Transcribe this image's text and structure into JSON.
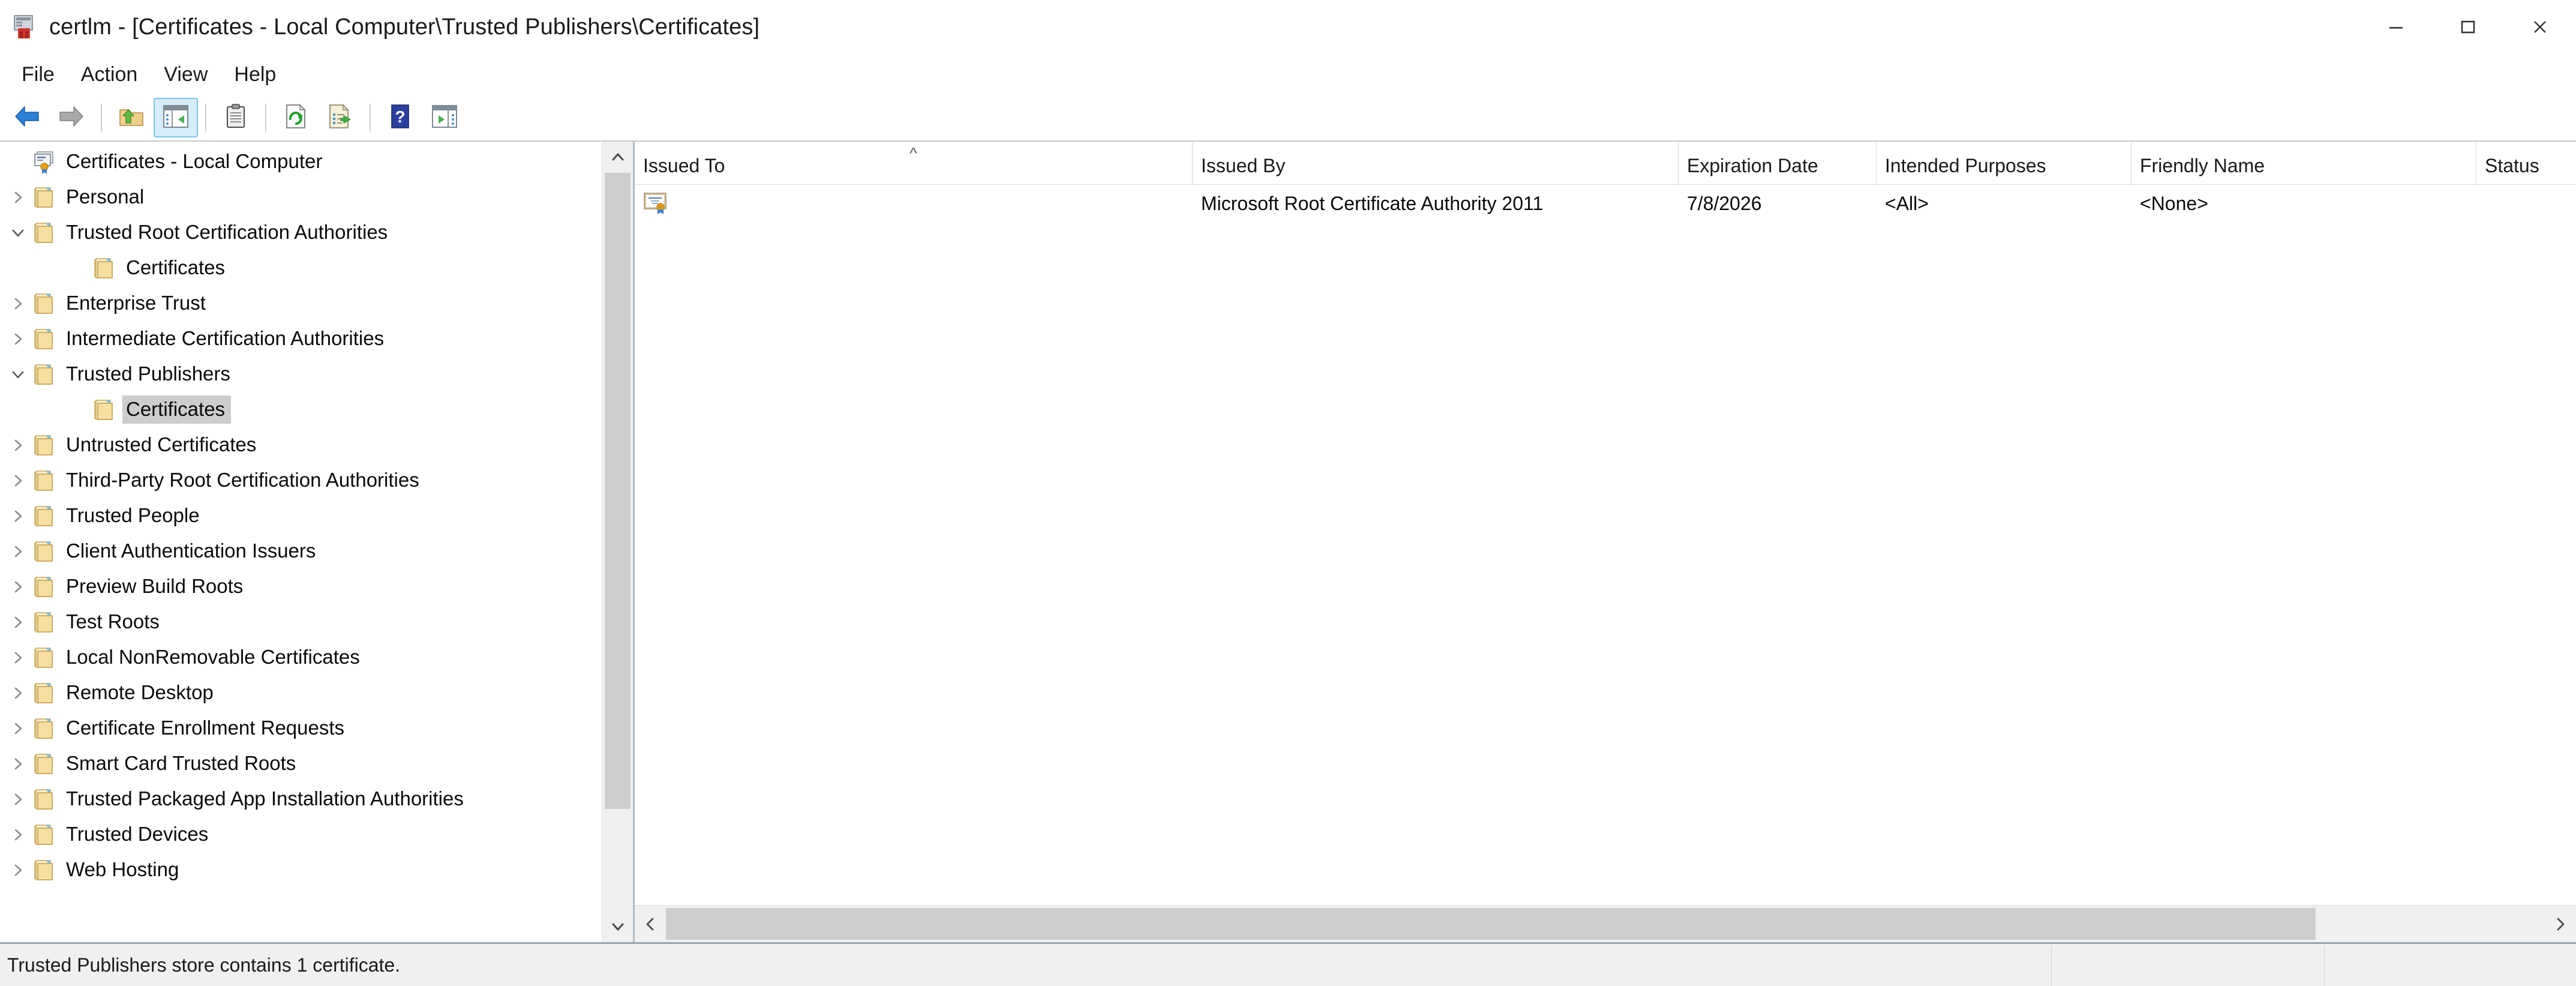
{
  "window": {
    "title": "certlm - [Certificates - Local Computer\\Trusted Publishers\\Certificates]",
    "app_icon": "certificate-store-icon",
    "controls": {
      "minimize": "minimize-button",
      "maximize": "maximize-button",
      "close": "close-button"
    }
  },
  "menubar": {
    "items": [
      {
        "label": "File"
      },
      {
        "label": "Action"
      },
      {
        "label": "View"
      },
      {
        "label": "Help"
      }
    ]
  },
  "toolbar": {
    "buttons": [
      {
        "icon": "back-arrow-icon",
        "enabled": true
      },
      {
        "icon": "forward-arrow-icon",
        "enabled": false
      },
      {
        "icon": "up-one-level-icon",
        "enabled": true
      },
      {
        "icon": "show-hide-console-tree-icon",
        "active": true
      },
      {
        "icon": "properties-icon",
        "enabled": true
      },
      {
        "icon": "refresh-icon",
        "enabled": true
      },
      {
        "icon": "export-list-icon",
        "enabled": true
      },
      {
        "icon": "help-icon",
        "enabled": true
      },
      {
        "icon": "show-hide-action-pane-icon",
        "enabled": true
      }
    ]
  },
  "tree": {
    "items": [
      {
        "label": "Certificates - Local Computer",
        "depth": 0,
        "icon": "certificate-store-icon",
        "expander": "none",
        "selected": false
      },
      {
        "label": "Personal",
        "depth": 1,
        "icon": "folder-icon",
        "expander": "collapsed",
        "selected": false
      },
      {
        "label": "Trusted Root Certification Authorities",
        "depth": 1,
        "icon": "folder-icon",
        "expander": "expanded",
        "selected": false
      },
      {
        "label": "Certificates",
        "depth": 2,
        "icon": "folder-icon",
        "expander": "none",
        "selected": false
      },
      {
        "label": "Enterprise Trust",
        "depth": 1,
        "icon": "folder-icon",
        "expander": "collapsed",
        "selected": false
      },
      {
        "label": "Intermediate Certification Authorities",
        "depth": 1,
        "icon": "folder-icon",
        "expander": "collapsed",
        "selected": false
      },
      {
        "label": "Trusted Publishers",
        "depth": 1,
        "icon": "folder-icon",
        "expander": "expanded",
        "selected": false
      },
      {
        "label": "Certificates",
        "depth": 2,
        "icon": "folder-icon",
        "expander": "none",
        "selected": true
      },
      {
        "label": "Untrusted Certificates",
        "depth": 1,
        "icon": "folder-icon",
        "expander": "collapsed",
        "selected": false
      },
      {
        "label": "Third-Party Root Certification Authorities",
        "depth": 1,
        "icon": "folder-icon",
        "expander": "collapsed",
        "selected": false
      },
      {
        "label": "Trusted People",
        "depth": 1,
        "icon": "folder-icon",
        "expander": "collapsed",
        "selected": false
      },
      {
        "label": "Client Authentication Issuers",
        "depth": 1,
        "icon": "folder-icon",
        "expander": "collapsed",
        "selected": false
      },
      {
        "label": "Preview Build Roots",
        "depth": 1,
        "icon": "folder-icon",
        "expander": "collapsed",
        "selected": false
      },
      {
        "label": "Test Roots",
        "depth": 1,
        "icon": "folder-icon",
        "expander": "collapsed",
        "selected": false
      },
      {
        "label": "Local NonRemovable Certificates",
        "depth": 1,
        "icon": "folder-icon",
        "expander": "collapsed",
        "selected": false
      },
      {
        "label": "Remote Desktop",
        "depth": 1,
        "icon": "folder-icon",
        "expander": "collapsed",
        "selected": false
      },
      {
        "label": "Certificate Enrollment Requests",
        "depth": 1,
        "icon": "folder-icon",
        "expander": "collapsed",
        "selected": false
      },
      {
        "label": "Smart Card Trusted Roots",
        "depth": 1,
        "icon": "folder-icon",
        "expander": "collapsed",
        "selected": false
      },
      {
        "label": "Trusted Packaged App Installation Authorities",
        "depth": 1,
        "icon": "folder-icon",
        "expander": "collapsed",
        "selected": false
      },
      {
        "label": "Trusted Devices",
        "depth": 1,
        "icon": "folder-icon",
        "expander": "collapsed",
        "selected": false
      },
      {
        "label": "Web Hosting",
        "depth": 1,
        "icon": "folder-icon",
        "expander": "collapsed",
        "selected": false
      }
    ]
  },
  "list": {
    "columns": [
      {
        "label": "Issued To",
        "key": "issued_to",
        "sort": "asc"
      },
      {
        "label": "Issued By",
        "key": "issued_by",
        "sort": "none"
      },
      {
        "label": "Expiration Date",
        "key": "expiration_date",
        "sort": "none"
      },
      {
        "label": "Intended Purposes",
        "key": "intended",
        "sort": "none"
      },
      {
        "label": "Friendly Name",
        "key": "friendly_name",
        "sort": "none"
      },
      {
        "label": "Status",
        "key": "status",
        "sort": "none"
      }
    ],
    "rows": [
      {
        "icon": "certificate-icon",
        "issued_to": "",
        "issued_by": "Microsoft Root Certificate Authority 2011",
        "expiration_date": "7/8/2026",
        "intended": "<All>",
        "friendly_name": "<None>",
        "status": ""
      }
    ],
    "sort_caret": "^"
  },
  "statusbar": {
    "message": "Trusted Publishers store contains 1 certificate."
  },
  "colors": {
    "accent_selection": "#cdcdcd",
    "toolbar_active": "#d5ecfb",
    "folder": "#f5d98a",
    "scrollbar_thumb": "#cdcdcd",
    "chrome": "#f0f0f0",
    "text": "#0a0a0a"
  }
}
